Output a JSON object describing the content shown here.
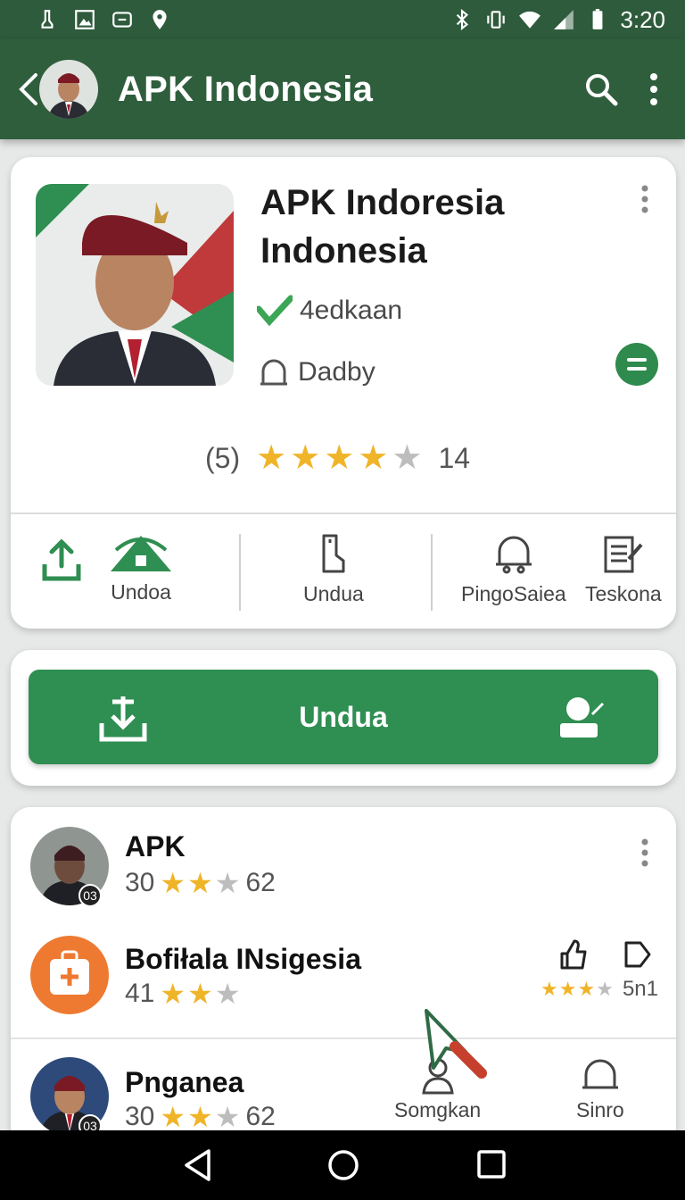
{
  "status_bar": {
    "time": "3:20"
  },
  "app_bar": {
    "title": "APK Indonesia"
  },
  "app_card": {
    "title_line1": "APK Indoresia",
    "title_line2": "Indonesia",
    "developer": "4edkaan",
    "category": "Dadby",
    "rating_count": "(5)",
    "rating_value": 4,
    "rating_extra": "14",
    "actions": [
      {
        "label": "Undoa"
      },
      {
        "label": "Undua"
      },
      {
        "label": "PingoSaiea"
      },
      {
        "label": "Teskona"
      }
    ]
  },
  "download_button": {
    "label": "Unduа"
  },
  "list": [
    {
      "name": "APK",
      "rating_left": "30",
      "stars": 2,
      "rating_right": "62",
      "badge": "03"
    },
    {
      "name": "Bofiłala INsigesia",
      "rating_left": "41",
      "stars": 2,
      "mini_rating": "5n1",
      "mini_stars": 3
    },
    {
      "name": "Pnganea",
      "rating_left": "30",
      "stars": 2,
      "rating_right": "62",
      "badge": "03"
    }
  ],
  "bottom_actions": [
    {
      "label": "Somgkan"
    },
    {
      "label": "Sinro"
    }
  ],
  "colors": {
    "primary": "#2f5e3d",
    "accent": "#2f8e52",
    "star": "#f0b429"
  }
}
